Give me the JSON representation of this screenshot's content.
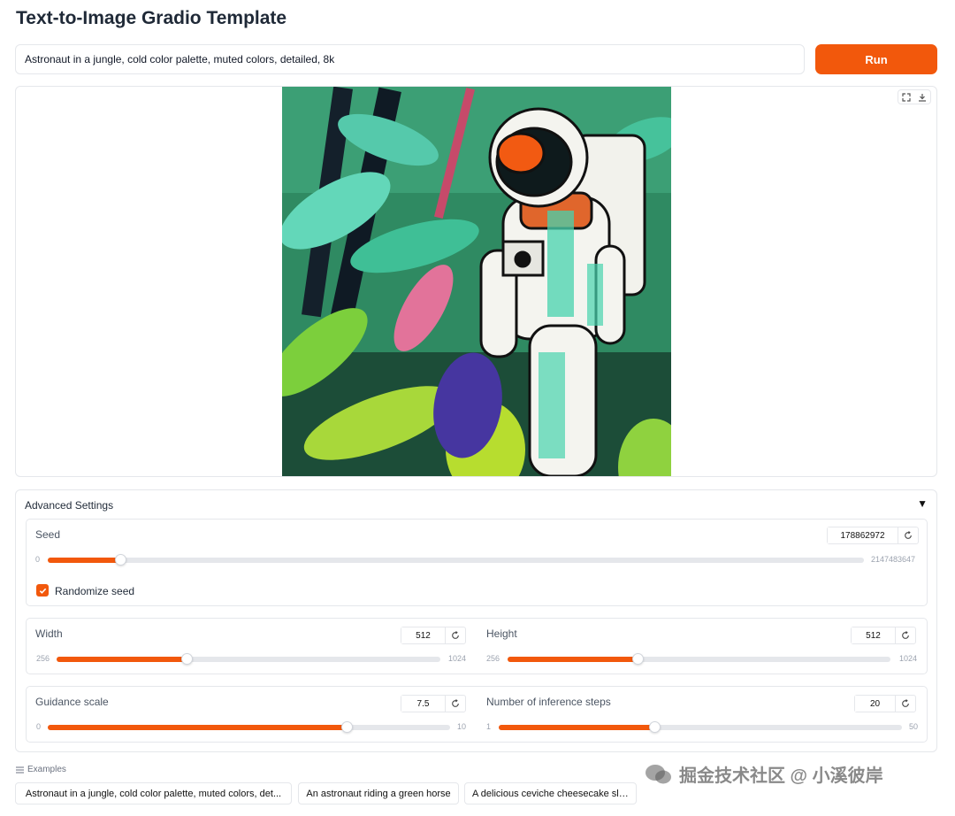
{
  "app": {
    "title": "Text-to-Image Gradio Template"
  },
  "prompt": {
    "value": "Astronaut in a jungle, cold color palette, muted colors, detailed, 8k"
  },
  "run_label": "Run",
  "image_panel": {
    "image_subject": "astronaut-in-jungle",
    "icons": [
      "fullscreen-icon",
      "download-icon"
    ]
  },
  "advanced": {
    "label": "Advanced Settings",
    "arrow": "▼",
    "seed": {
      "label": "Seed",
      "value": "178862972",
      "min": "0",
      "max": "2147483647",
      "fraction": 0.08
    },
    "randomize": {
      "label": "Randomize seed",
      "checked": true
    },
    "width": {
      "label": "Width",
      "value": "512",
      "min": "256",
      "max": "1024",
      "fraction": 0.333
    },
    "height": {
      "label": "Height",
      "value": "512",
      "min": "256",
      "max": "1024",
      "fraction": 0.333
    },
    "guidance": {
      "label": "Guidance scale",
      "value": "7.5",
      "min": "0",
      "max": "10",
      "fraction": 0.75
    },
    "steps": {
      "label": "Number of inference steps",
      "value": "20",
      "min": "1",
      "max": "50",
      "fraction": 0.388
    }
  },
  "examples": {
    "label": "Examples",
    "items": [
      "Astronaut in a jungle, cold color palette, muted colors, det...",
      "An astronaut riding a green horse",
      "A delicious ceviche cheesecake slice"
    ]
  },
  "watermark": "掘金技术社区 @ 小溪彼岸",
  "colors": {
    "accent": "#f2580c",
    "border": "#e5e7eb",
    "muted_text": "#9ca3af"
  }
}
